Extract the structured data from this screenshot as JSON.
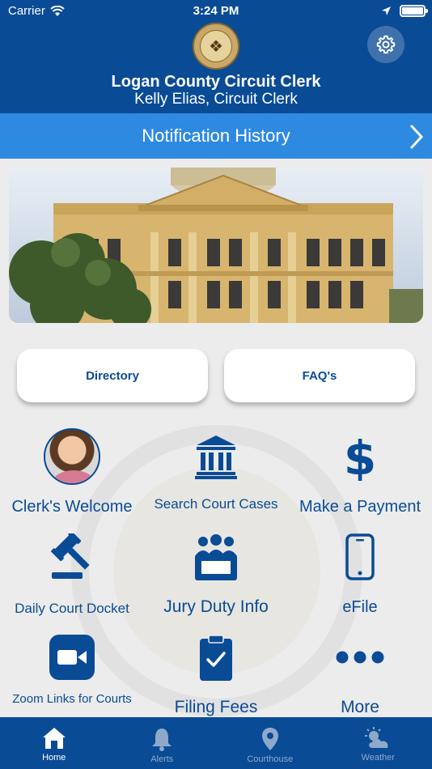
{
  "status_bar": {
    "carrier": "Carrier",
    "time": "3:24 PM"
  },
  "header": {
    "title": "Logan County Circuit Clerk",
    "subtitle": "Kelly Elias, Circuit Clerk"
  },
  "notification_bar": {
    "label": "Notification History"
  },
  "buttons": {
    "directory": "Directory",
    "faqs": "FAQ's"
  },
  "grid": [
    {
      "label": "Clerk's Welcome",
      "icon": "clerk-photo"
    },
    {
      "label": "Search Court Cases",
      "icon": "courthouse-icon"
    },
    {
      "label": "Make a Payment",
      "icon": "dollar-icon"
    },
    {
      "label": "Daily Court Docket",
      "icon": "gavel-icon"
    },
    {
      "label": "Jury Duty Info",
      "icon": "jury-icon"
    },
    {
      "label": "eFile",
      "icon": "phone-icon"
    },
    {
      "label": "Zoom Links for Courts",
      "icon": "video-camera-icon"
    },
    {
      "label": "Filing Fees",
      "icon": "clipboard-check-icon"
    },
    {
      "label": "More",
      "icon": "more-dots-icon"
    }
  ],
  "tabs": [
    {
      "label": "Home",
      "icon": "home-icon"
    },
    {
      "label": "Alerts",
      "icon": "bell-icon"
    },
    {
      "label": "Courthouse",
      "icon": "location-pin-icon"
    },
    {
      "label": "Weather",
      "icon": "weather-icon"
    }
  ],
  "colors": {
    "primary": "#0a4b96",
    "accent": "#2e8ae0",
    "background": "#ececec"
  }
}
